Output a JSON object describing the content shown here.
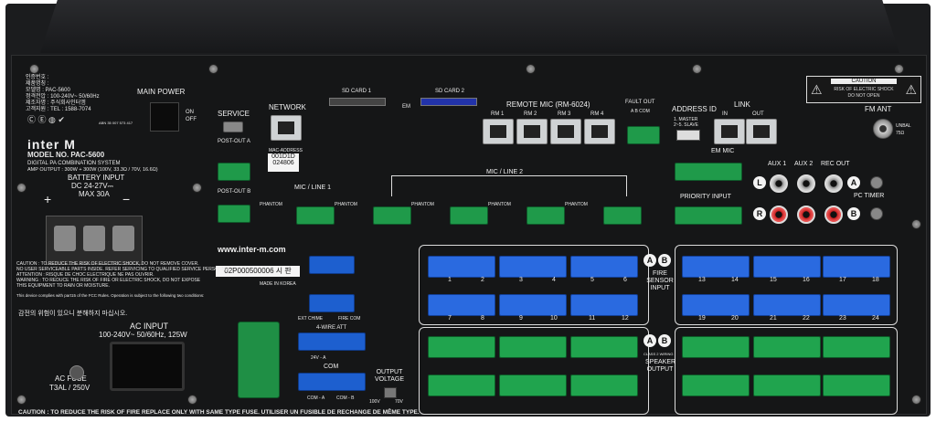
{
  "info_block": [
    "인증번호 :",
    "제품명칭 :",
    "모델명 : PAC-5600",
    "정격전압 : 100-240V~ 50/60Hz",
    "제조자명 : 주식회사인터엠",
    "고객지원 : TEL : 1588-7074"
  ],
  "abn": "ABN 35 007 573 417",
  "brand": "inter M",
  "model": "MODEL NO. PAC-5600",
  "model_desc": "DIGITAL PA COMBINATION SYSTEM",
  "amp_output": "AMP OUTPUT : 300W + 300W (100V, 33.3Ω / 70V, 16.6Ω)",
  "battery": {
    "title": "BATTERY INPUT",
    "line1": "DC 24-27V⎓",
    "line2": "MAX 30A",
    "plus": "+",
    "minus": "−"
  },
  "main_power": {
    "label": "MAIN POWER",
    "on": "ON",
    "off": "OFF"
  },
  "service": "SERVICE",
  "network": "NETWORK",
  "mac": {
    "label": "MAC-ADDRESS",
    "line1": "001D1D",
    "line2": "024806"
  },
  "post_out_a": "POST-OUT A",
  "post_out_b": "POST-OUT B",
  "sd1": "SD CARD 1",
  "sd2": "SD CARD 2",
  "em": "EM",
  "remote_mic": {
    "title": "REMOTE MIC (RM-6024)",
    "ports": [
      "RM 1",
      "RM 2",
      "RM 3",
      "RM 4"
    ]
  },
  "fault_out": {
    "title": "FAULT OUT",
    "pins": "A  B COM"
  },
  "address_id": {
    "title": "ADDRESS ID",
    "l1": "1. MASTER",
    "l2": "2~5. SLAVE"
  },
  "link": {
    "title": "LINK",
    "in": "IN",
    "out": "OUT"
  },
  "caution_box": {
    "title": "CAUTION",
    "l1": "RISK OF ELECTRIC SHOCK",
    "l2": "DO NOT OPEN"
  },
  "fm_ant": {
    "title": "FM ANT",
    "sub": "UNBAL 75Ω"
  },
  "em_mic": "EM MIC",
  "priority_input": "PRIORITY INPUT",
  "aux1": "AUX 1",
  "aux2": "AUX 2",
  "rec_out": "REC OUT",
  "pc_timer": "PC TIMER",
  "l": "L",
  "r": "R",
  "mic_line1": "MIC / LINE 1",
  "mic_line2": "MIC / LINE 2",
  "phantom": "PHANTOM",
  "url": "www.inter-m.com",
  "serial": "02P000500006  시 판",
  "made_in": "MADE IN KOREA",
  "warnings": [
    "CAUTION : TO REDUCE THE RISK OF ELECTRIC SHOCK, DO NOT REMOVE COVER.",
    "NO USER SERVICEABLE PARTS INSIDE. REFER SERVICING TO QUALIFIED SERVICE PERSONNEL.",
    "ATTENTION : RISQUE DE CHOC ELECTRIQUE NE PAS OUVRIR.",
    "WARNING : TO REDUCE THE RISK OF FIRE OR ELECTRIC SHOCK, DO NOT EXPOSE",
    "THIS EQUIPMENT TO RAIN OR MOISTURE."
  ],
  "fcc": "This device complies with part15 of the FCC Rules. Operation is subject to the following two conditions:",
  "korean_warning": "감전의 위험이 있으니 분해하지 마십시오.",
  "ac_input": {
    "title": "AC INPUT",
    "spec": "100-240V~ 50/60Hz, 125W"
  },
  "ac_fuse": {
    "title": "AC FUSE",
    "spec": "T3AL / 250V"
  },
  "ext_chime": "EXT CHIME",
  "fire_com": "FIRE COM",
  "four_wire": "4-WIRE ATT",
  "com": "COM",
  "v24a": "24V - A",
  "com_a": "COM - A",
  "com_b": "COM - B",
  "output_voltage": {
    "title": "OUTPUT VOLTAGE",
    "v100": "100V",
    "v70": "70V"
  },
  "fire_sensor": {
    "title": "FIRE SENSOR INPUT",
    "a": "A",
    "b": "B"
  },
  "speaker_output": {
    "title": "SPEAKER OUTPUT",
    "sub": "CLASS 2 WIRING"
  },
  "fire_numbers_top_left": [
    "1",
    "2",
    "3",
    "4",
    "5",
    "6"
  ],
  "fire_numbers_bot_left": [
    "7",
    "8",
    "9",
    "10",
    "11",
    "12"
  ],
  "fire_numbers_top_right": [
    "13",
    "14",
    "15",
    "16",
    "17",
    "18"
  ],
  "fire_numbers_bot_right": [
    "19",
    "20",
    "21",
    "22",
    "23",
    "24"
  ],
  "bottom_caution": "CAUTION : TO REDUCE THE RISK OF FIRE REPLACE ONLY WITH SAME TYPE FUSE. UTILISER UN FUSIBLE DE RECHANGE DE MÊME TYPE."
}
